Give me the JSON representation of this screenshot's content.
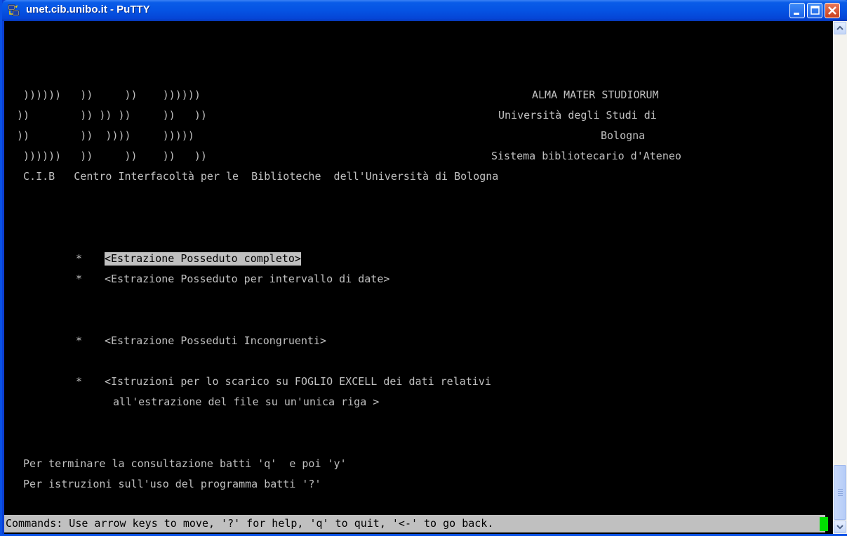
{
  "window": {
    "title": "unet.cib.unibo.it - PuTTY",
    "icon": "putty-icon"
  },
  "banner": {
    "logo_rows": [
      " ))))))   ))     ))    ))))))",
      "))        )) )) ))     ))   ))",
      "))        ))  ))))     )))))",
      " ))))))   ))     ))    ))   ))"
    ],
    "right_lines": [
      "ALMA MATER STUDIORUM",
      "Università degli Studi di",
      "Bologna",
      "Sistema bibliotecario d'Ateneo"
    ],
    "cib_line": " C.I.B   Centro Interfacoltà per le  Biblioteche  dell'Università di Bologna"
  },
  "menu": {
    "bullet": "*",
    "items": [
      "<Estrazione Posseduto completo>",
      "<Estrazione Posseduto per intervallo di date>",
      "<Estrazione Posseduti Incongruenti>",
      "<Istruzioni per lo scarico su FOGLIO EXCELL dei dati relativi"
    ],
    "item4_continuation": "all'estrazione del file su un'unica riga >",
    "selected_index": 0
  },
  "footer": {
    "quit_hint": " Per terminare la consultazione batti 'q'  e poi 'y'",
    "help_hint": " Per istruzioni sull'uso del programma batti '?'"
  },
  "status": {
    "text": "Commands: Use arrow keys to move, '?' for help, 'q' to quit, '<-' to go back."
  },
  "colors": {
    "terminal_bg": "#000000",
    "terminal_fg": "#c0c0c0",
    "highlight_bg": "#c0c0c0",
    "cursor": "#00e000",
    "titlebar": "#0553e3"
  }
}
